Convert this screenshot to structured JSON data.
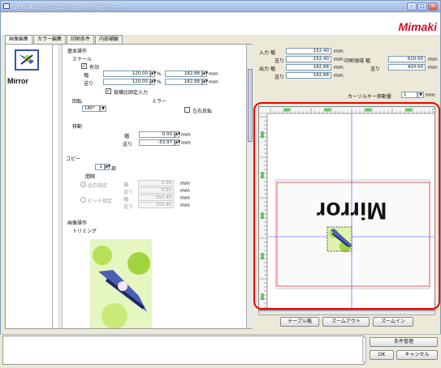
{
  "window": {
    "title": "GP-604D : ジョブエディタ ( フルカラー )",
    "brand": "Mimaki",
    "min": "–",
    "max": "□",
    "close": "×"
  },
  "tabs": [
    "画像編集",
    "カラー編集",
    "印刷条件",
    "内部補観"
  ],
  "thumb": {
    "label": "Mirror"
  },
  "basic": {
    "heading": "基本操作",
    "scale": "スケール",
    "enabled": "有効",
    "width_label": "幅",
    "feed_label": "送り",
    "scale_w": "120.00",
    "scale_f": "120.00",
    "pct": "%",
    "mm_w": "182.88",
    "mm_f": "182.88",
    "mm": "mm",
    "aspect": "縦横比固定入力"
  },
  "rotation": {
    "label": "回転",
    "value": "180°",
    "mirror_label": "ミラー",
    "lr_flip": "左右反転"
  },
  "move": {
    "label": "移動",
    "width_label": "幅",
    "feed_label": "送り",
    "w": "0.00",
    "f": "-53.97",
    "mm": "mm"
  },
  "copy": {
    "label": "コピー",
    "count": "1",
    "unit": "部",
    "spacing": "間隔",
    "auto": "余白指定",
    "pitch": "ピッチ指定",
    "w_label": "幅",
    "f_label": "送り",
    "a_w": "0.00",
    "a_f": "0.00",
    "p_w": "152.40",
    "p_f": "152.40",
    "mm": "mm"
  },
  "image_op": {
    "label": "画像操作",
    "trim": "トリミング"
  },
  "info": {
    "input_w_label": "入力 幅",
    "feed_label": "送り",
    "output_w_label": "出力 幅",
    "input_w": "152.40",
    "input_f": "152.40",
    "output_w": "182.88",
    "output_f": "182.88",
    "mm": "mm",
    "print_area_label": "印刷領域 幅",
    "print_area_w": "610.00",
    "print_area_f": "420.00",
    "cursor_label": "カーソルキー移動量",
    "cursor_value": "1",
    "cursor_unit": "mm"
  },
  "preview": {
    "mirror_text": "Mirror"
  },
  "buttons": {
    "table_width": "テーブル幅",
    "zoom_out": "ズームアウト",
    "zoom_in": "ズームイン",
    "condition_mgmt": "条件管理",
    "ok": "OK",
    "cancel": "キャンセル"
  },
  "colors": {
    "highlight": "#e00000",
    "brand": "#d0102a",
    "print_area_border": "#e03a3a",
    "cursor_line": "#4040ff",
    "ruler_marks": "#2bb52b"
  }
}
